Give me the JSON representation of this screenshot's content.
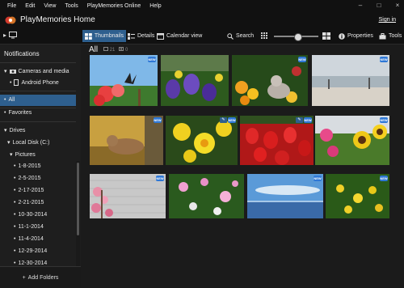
{
  "menu": [
    "File",
    "Edit",
    "View",
    "Tools",
    "PlayMemories Online",
    "Help"
  ],
  "window_controls": [
    "–",
    "□",
    "×"
  ],
  "app": {
    "title": "PlayMemories Home",
    "signin": "Sign in"
  },
  "toolbar": {
    "tabs": [
      {
        "label": "Thumbnails",
        "icon": "thumbnails-icon",
        "active": true
      },
      {
        "label": "Details",
        "icon": "details-icon"
      },
      {
        "label": "Calendar view",
        "icon": "calendar-icon"
      }
    ],
    "search": "Search",
    "properties": "Properties",
    "tools": "Tools",
    "zoom_level": 0.52
  },
  "sidebar": {
    "title": "Notifications",
    "cameras": "Cameras and media",
    "android": "Android Phone",
    "all": "All",
    "favorites": "Favorites",
    "drives": "Drives",
    "local_disk": "Local Disk (C:)",
    "pictures": "Pictures",
    "dates": [
      "1-8-2015",
      "2-5-2015",
      "2-17-2015",
      "2-21-2015",
      "10-30-2014",
      "11-1-2014",
      "11-4-2014",
      "12-29-2014",
      "12-30-2014"
    ],
    "add_folders": "Add Folders"
  },
  "main": {
    "heading": "All",
    "photo_count": "21",
    "video_count": "0",
    "badge_new": "NEW",
    "thumbnails": [
      {
        "name": "butterfly-flowers",
        "new": true
      },
      {
        "name": "purple-iris",
        "new": false
      },
      {
        "name": "cat-in-garden",
        "new": true
      },
      {
        "name": "beach-sky",
        "new": true
      },
      {
        "name": "cat-on-bench",
        "new": true
      },
      {
        "name": "yellow-daffodils",
        "new": true
      },
      {
        "name": "red-tulips",
        "new": false
      },
      {
        "name": "sunflowers",
        "new": true
      },
      {
        "name": "pink-blossoms",
        "new": true
      },
      {
        "name": "pink-flowers",
        "new": false
      },
      {
        "name": "sea-horizon",
        "new": true
      },
      {
        "name": "citrus-tree",
        "new": true
      }
    ]
  }
}
